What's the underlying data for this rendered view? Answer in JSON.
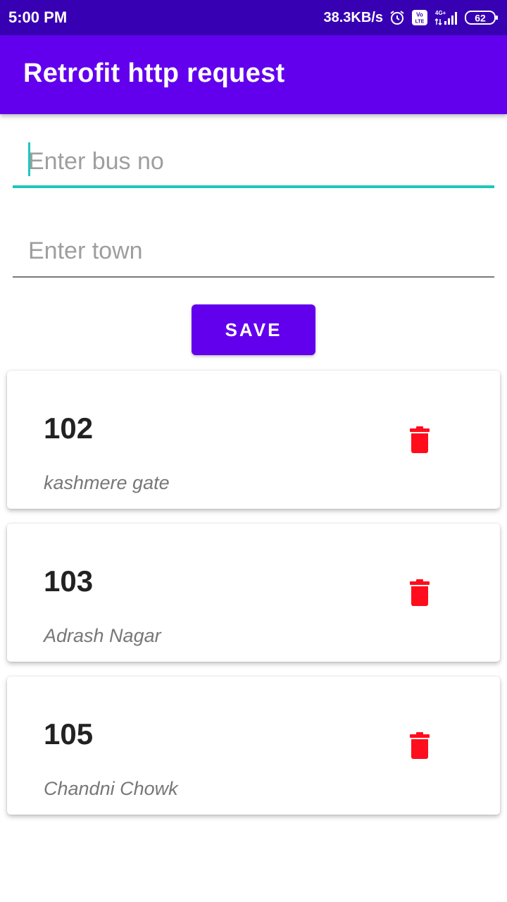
{
  "status_bar": {
    "time": "5:00 PM",
    "network_speed": "38.3KB/s",
    "icons": [
      "alarm-icon",
      "volte-icon",
      "4g-signal-icon",
      "battery-icon"
    ],
    "volte_label": "Vo LTE",
    "network_type": "4G+",
    "battery_level": "62"
  },
  "app_bar": {
    "title": "Retrofit http request"
  },
  "form": {
    "bus_no_placeholder": "Enter bus no",
    "town_placeholder": "Enter town",
    "save_label": "SAVE"
  },
  "buses": [
    {
      "number": "102",
      "town": "kashmere gate",
      "action_icon": "delete-icon"
    },
    {
      "number": "103",
      "town": "Adrash Nagar",
      "action_icon": "delete-icon"
    },
    {
      "number": "105",
      "town": "Chandni Chowk",
      "action_icon": "delete-icon"
    }
  ],
  "colors": {
    "status_bar": "#3700b3",
    "primary": "#6200ee",
    "accent": "#1ec8b9",
    "delete": "#ff0d1d"
  }
}
